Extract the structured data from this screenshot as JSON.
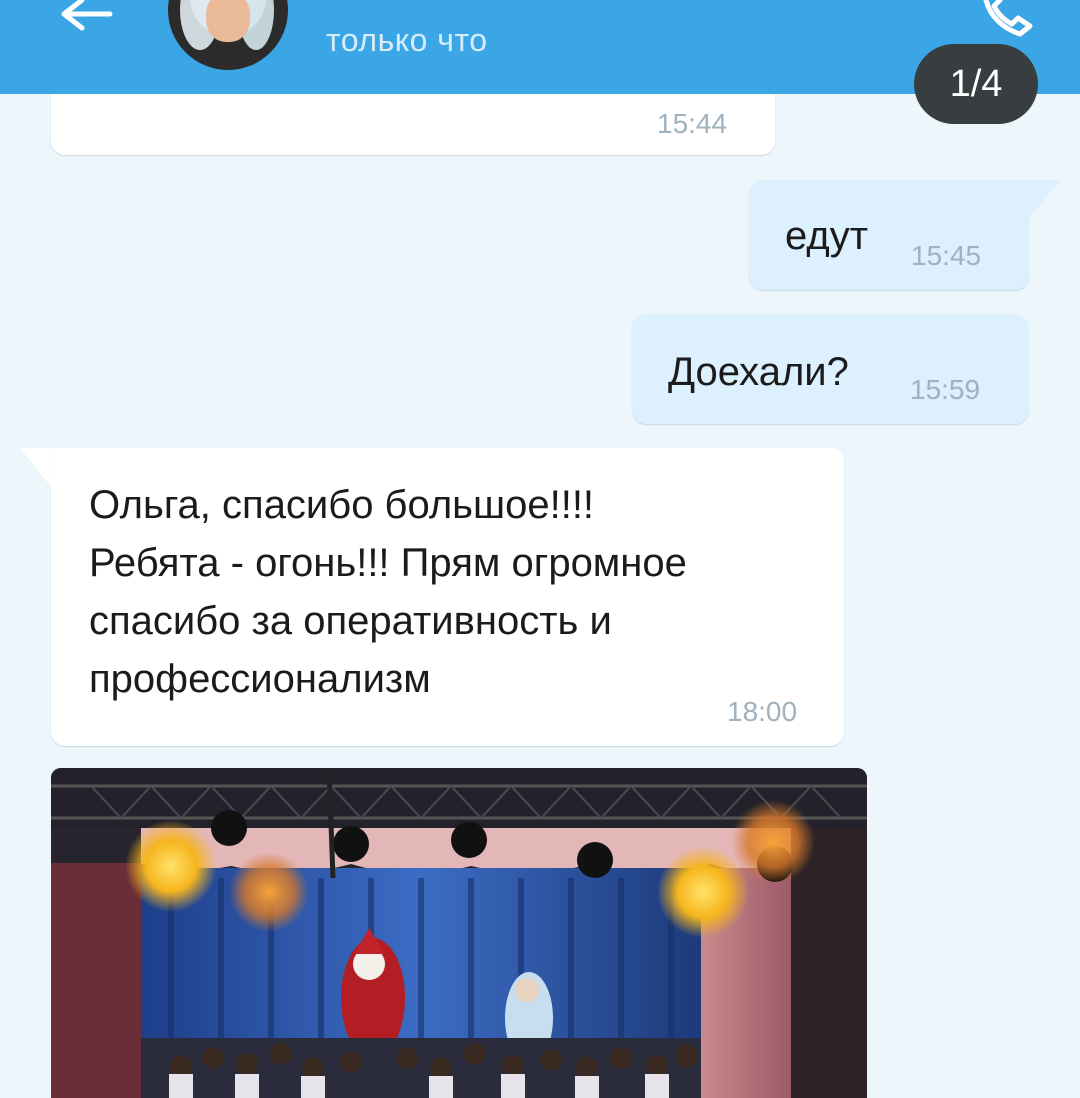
{
  "header": {
    "status": "только что",
    "back_icon": "arrow-left-icon",
    "call_icon": "phone-icon",
    "background": "#3aa6e6"
  },
  "media_counter": "1/4",
  "messages": [
    {
      "direction": "incoming",
      "text": "",
      "time": "15:44"
    },
    {
      "direction": "outgoing",
      "text": "едут",
      "time": "15:45"
    },
    {
      "direction": "outgoing",
      "text": "Доехали?",
      "time": "15:59"
    },
    {
      "direction": "incoming",
      "text": "Ольга, спасибо большое!!!!\nРебята - огонь!!! Прям огромное\nспасибо за оперативность и\nпрофессионализм",
      "time": "18:00"
    }
  ],
  "photo": {
    "description_icon": "image-attachment"
  },
  "colors": {
    "chat_background": "#ecf6fb",
    "incoming_bubble": "#ffffff",
    "outgoing_bubble": "#dcf0fd",
    "badge": "#383d40"
  }
}
